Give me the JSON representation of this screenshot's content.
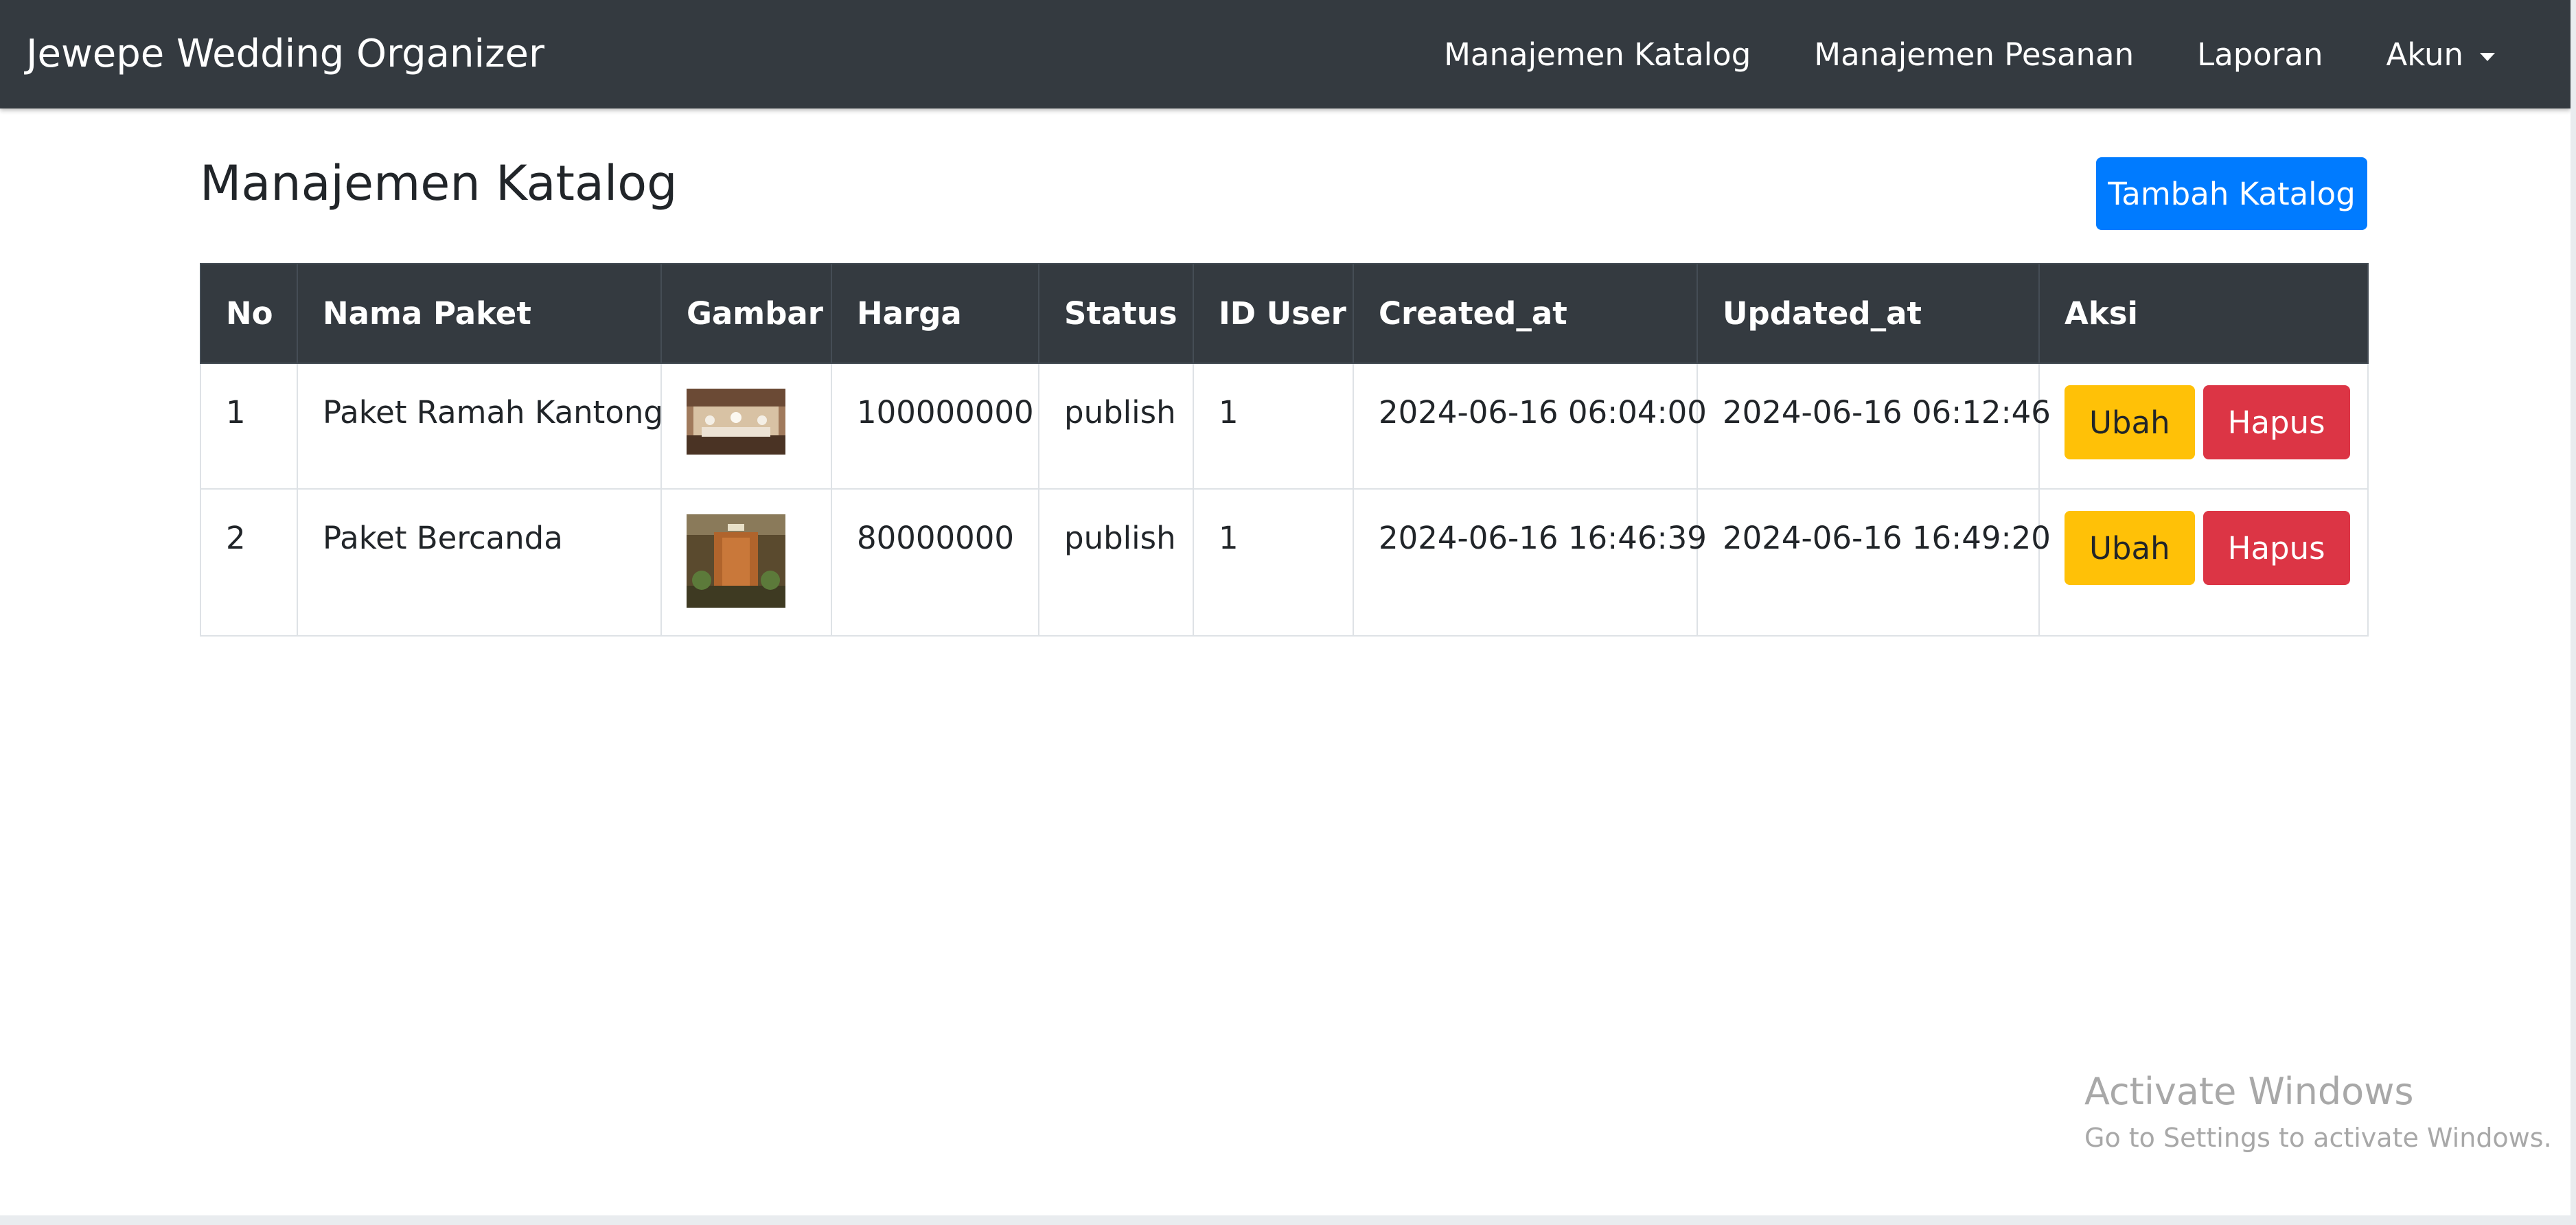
{
  "navbar": {
    "brand": "Jewepe Wedding Organizer",
    "links": [
      "Manajemen Katalog",
      "Manajemen Pesanan",
      "Laporan",
      "Akun"
    ]
  },
  "main": {
    "title": "Manajemen Katalog",
    "add_button": "Tambah Katalog"
  },
  "table": {
    "headers": [
      "No",
      "Nama Paket",
      "Gambar",
      "Harga",
      "Status",
      "ID User",
      "Created_at",
      "Updated_at",
      "Aksi"
    ],
    "rows": [
      {
        "no": "1",
        "name": "Paket Ramah Kantong",
        "image_icon": "wedding-venue-thumbnail",
        "price": "100000000",
        "status": "publish",
        "user_id": "1",
        "created_at": "2024-06-16 06:04:00",
        "updated_at": "2024-06-16 06:12:46",
        "edit": "Ubah",
        "delete": "Hapus"
      },
      {
        "no": "2",
        "name": "Paket Bercanda",
        "image_icon": "wedding-decor-thumbnail",
        "price": "80000000",
        "status": "publish",
        "user_id": "1",
        "created_at": "2024-06-16 16:46:39",
        "updated_at": "2024-06-16 16:49:20",
        "edit": "Ubah",
        "delete": "Hapus"
      }
    ]
  },
  "watermark": {
    "title": "Activate Windows",
    "subtitle": "Go to Settings to activate Windows."
  },
  "colors": {
    "navbar": "#343a40",
    "primary": "#007bff",
    "warning": "#ffc107",
    "danger": "#dc3545"
  }
}
